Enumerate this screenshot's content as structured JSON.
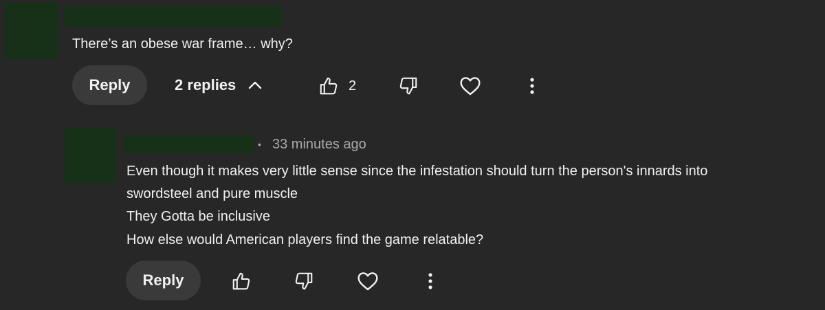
{
  "comment": {
    "text": "There’s an obese war frame… why?",
    "reply_label": "Reply",
    "replies_label": "2 replies",
    "like_count": "2"
  },
  "reply": {
    "separator": "•",
    "timestamp": "33 minutes ago",
    "lines": [
      "Even though it makes very little sense since the infestation should turn the person's innards into",
      "swordsteel and pure muscle",
      "They Gotta be inclusive",
      "How else would American players find the game relatable?"
    ],
    "reply_label": "Reply"
  },
  "colors": {
    "background": "#272727",
    "redaction": "#173018",
    "pill": "#3a3a3a",
    "text": "#f1f1f1",
    "meta_text": "#aaaaaa"
  },
  "icons": [
    "thumbs-up-icon",
    "thumbs-down-icon",
    "heart-icon",
    "more-vert-icon",
    "chevron-up-icon"
  ]
}
